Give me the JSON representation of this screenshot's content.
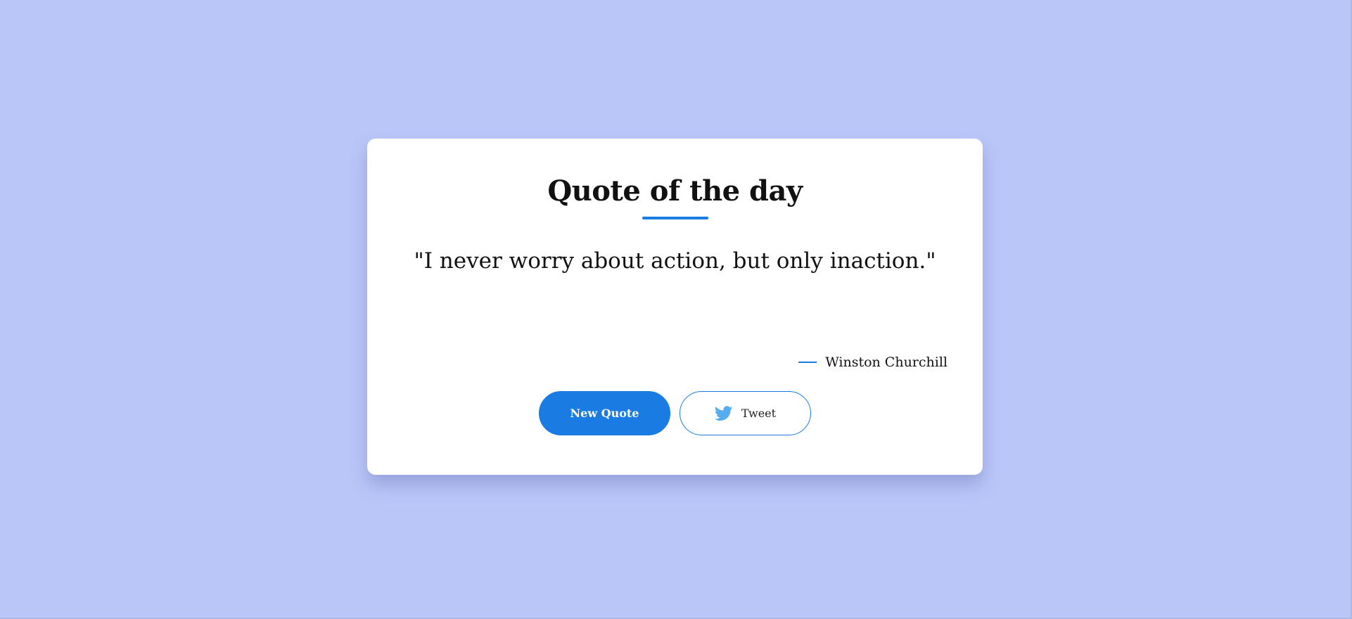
{
  "page": {
    "background_color": "#bac6f8"
  },
  "card": {
    "title": "Quote of the day",
    "quote": "\"I never worry about action, but only inaction.\"",
    "author": "Winston Churchill",
    "accent_color": "#1a7be3"
  },
  "buttons": {
    "new_quote_label": "New Quote",
    "tweet_label": "Tweet",
    "tweet_icon": "twitter-bird-icon",
    "tweet_icon_color": "#55acee"
  }
}
